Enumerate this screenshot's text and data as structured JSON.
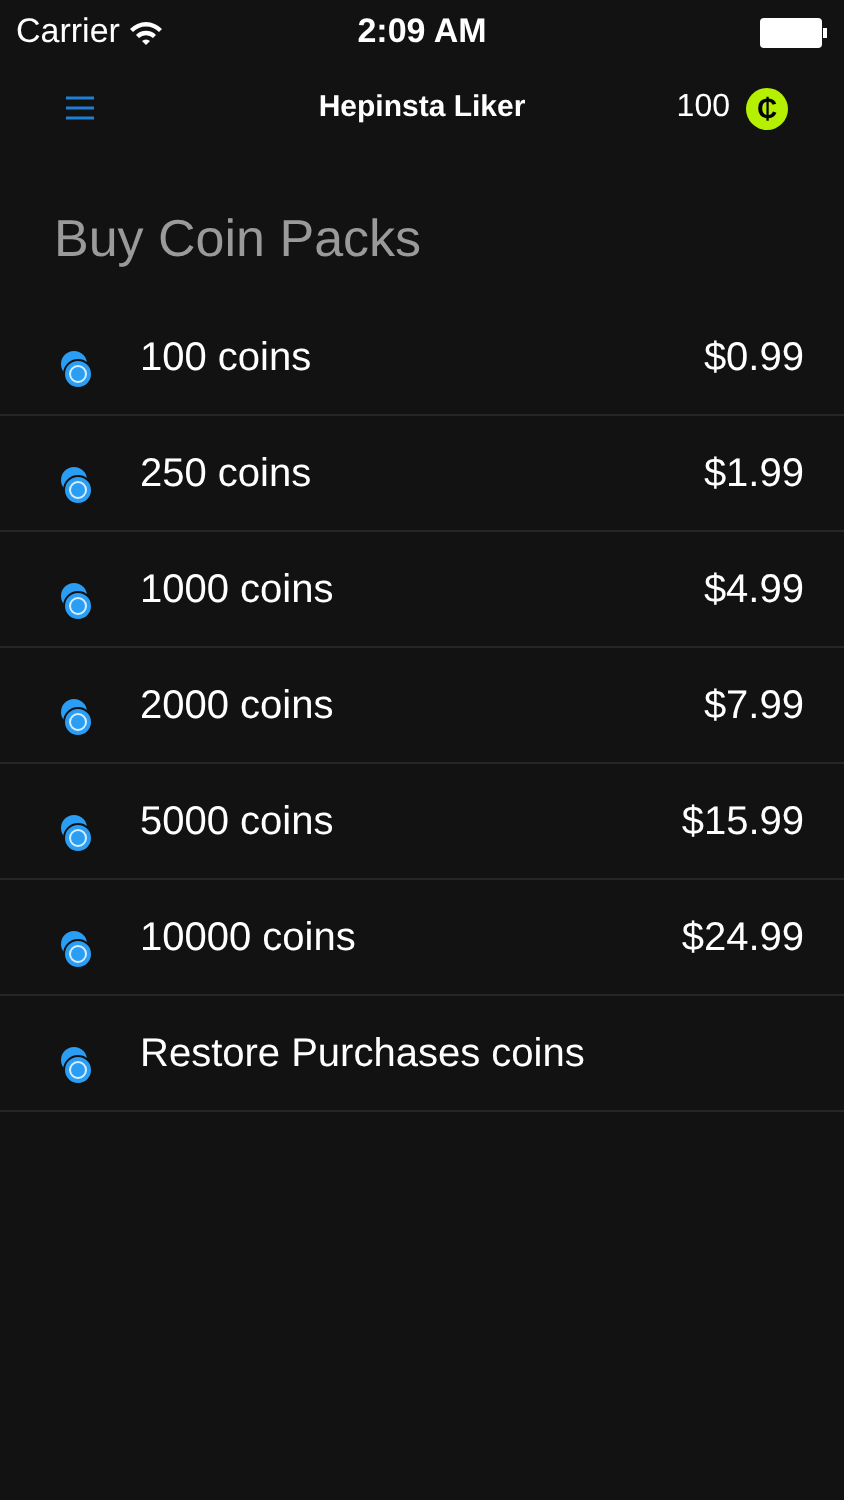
{
  "status_bar": {
    "carrier": "Carrier",
    "time": "2:09 AM"
  },
  "nav": {
    "title": "Hepinsta Liker",
    "balance": "100",
    "coin_symbol": "₵"
  },
  "heading": "Buy Coin Packs",
  "packs": [
    {
      "label": "100 coins",
      "price": "$0.99"
    },
    {
      "label": "250 coins",
      "price": "$1.99"
    },
    {
      "label": "1000 coins",
      "price": "$4.99"
    },
    {
      "label": "2000 coins",
      "price": "$7.99"
    },
    {
      "label": "5000 coins",
      "price": "$15.99"
    },
    {
      "label": "10000 coins",
      "price": "$24.99"
    },
    {
      "label": "Restore Purchases coins"
    }
  ]
}
